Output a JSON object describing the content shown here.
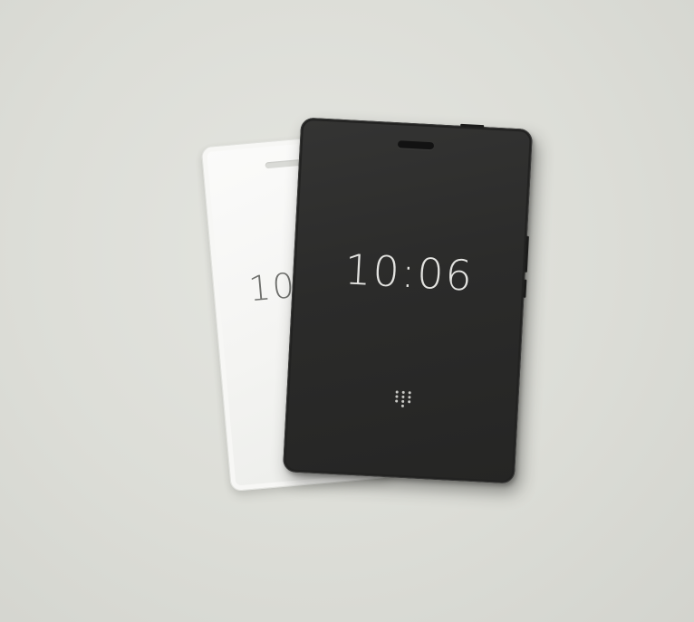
{
  "photo": {
    "background_color": "#dcddd7"
  },
  "white_phone": {
    "body_color": "#f4f4f2",
    "screen_time": "10:",
    "time_color": "#6e6f6c"
  },
  "black_phone": {
    "body_color": "#2b2b2a",
    "screen_time": "10:06",
    "time_color": "#e4e4e1",
    "keypad_icon": "keypad-grid-icon"
  }
}
